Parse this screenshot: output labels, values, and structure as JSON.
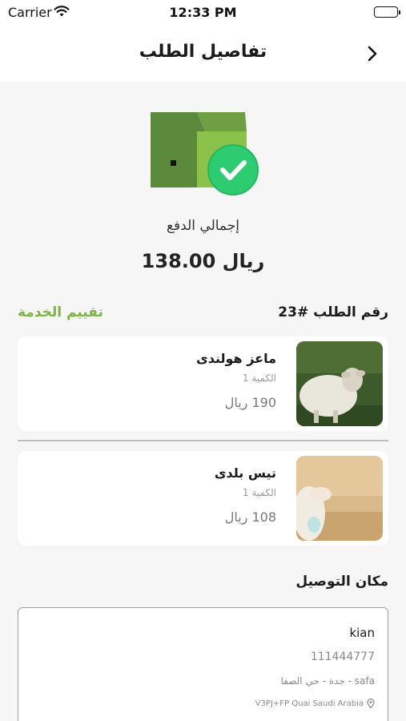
{
  "status_bar": {
    "carrier": "Carrier",
    "time": "12:33 PM"
  },
  "nav": {
    "title": "تفاصيل الطلب",
    "back_icon": "chevron-right-icon"
  },
  "payment": {
    "label": "إجمالي الدفع",
    "total": "138.00 ريال"
  },
  "order": {
    "number": "رقم الطلب #23",
    "rate_service": "تقييم الخدمة"
  },
  "items": [
    {
      "name": "ماعز هولندى",
      "quantity": "الكمية 1",
      "price": "190 ريال"
    },
    {
      "name": "تيس بلدى",
      "quantity": "الكمية 1",
      "price": "108 ريال"
    }
  ],
  "delivery": {
    "title": "مكان التوصيل",
    "name": "kian",
    "phone": "111444777",
    "area": "جدة - حي الصفا - safa",
    "location": "V3PJ+FP Quai Saudi Arabia"
  },
  "colors": {
    "accent_green": "#7cb342",
    "box_dark": "#5b8a3c",
    "box_light": "#8bc34a",
    "check_badge": "#2ecc71"
  }
}
